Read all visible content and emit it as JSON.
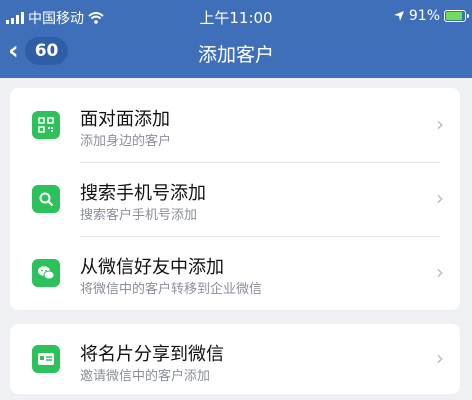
{
  "status_bar": {
    "carrier": "中国移动",
    "time": "上午11:00",
    "battery": "91%",
    "icons": [
      "signal-icon",
      "wifi-icon",
      "location-icon",
      "battery-charging-icon"
    ]
  },
  "nav": {
    "back_count": "60",
    "title": "添加客户"
  },
  "menu": [
    {
      "title": "面对面添加",
      "subtitle": "添加身边的客户",
      "icon": "qr-code-icon"
    },
    {
      "title": "搜索手机号添加",
      "subtitle": "搜索客户手机号添加",
      "icon": "search-icon"
    },
    {
      "title": "从微信好友中添加",
      "subtitle": "将微信中的客户转移到企业微信",
      "icon": "wechat-icon"
    }
  ],
  "share": {
    "title": "将名片分享到微信",
    "subtitle": "邀请微信中的客户添加",
    "icon": "business-card-icon"
  },
  "colors": {
    "primary": "#3f6fb8",
    "icon_green": "#2cc15b",
    "background": "#eef0f3"
  }
}
